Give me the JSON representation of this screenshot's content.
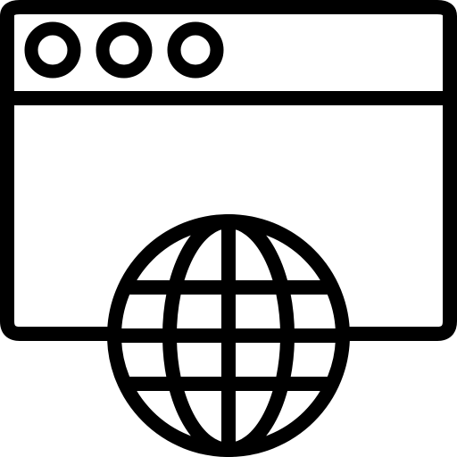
{
  "icon": {
    "name": "web-browser-globe-icon",
    "stroke_color": "#000000",
    "background_color": "#ffffff"
  },
  "window": {
    "control_dots": [
      "dot-1",
      "dot-2",
      "dot-3"
    ]
  },
  "globe": {
    "latitude_lines": 3,
    "longitude_lines": 3
  }
}
